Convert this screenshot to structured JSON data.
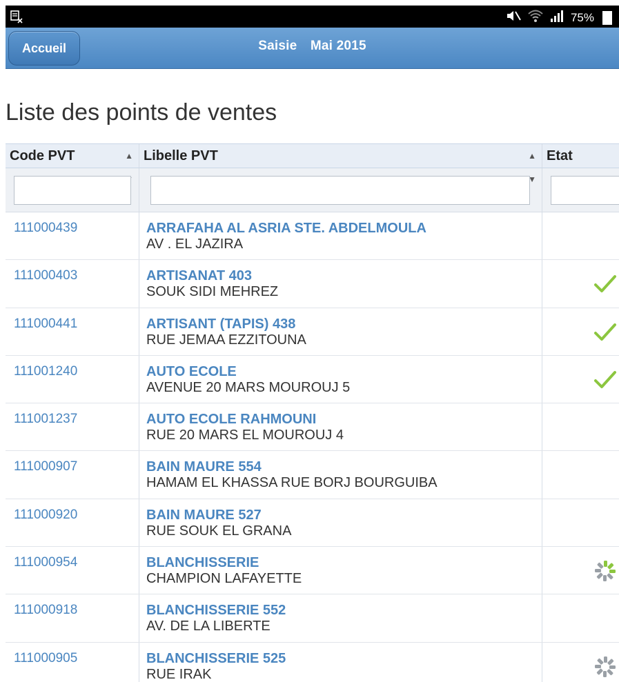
{
  "status_bar": {
    "battery": "75%",
    "icons": [
      "notification-icon",
      "mute-icon",
      "wifi-icon",
      "signal-icon",
      "battery-icon"
    ]
  },
  "header": {
    "back_label": "Accueil",
    "title_mode": "Saisie",
    "title_period": "Mai 2015"
  },
  "page": {
    "title": "Liste des points de ventes"
  },
  "table": {
    "columns": [
      "Code PVT",
      "Libelle PVT",
      "Etat"
    ],
    "rows": [
      {
        "code": "111000439",
        "name": "ARRAFAHA AL ASRIA STE. ABDELMOULA",
        "address": "AV . EL JAZIRA",
        "etat": "none"
      },
      {
        "code": "111000403",
        "name": "ARTISANAT 403",
        "address": "SOUK SIDI MEHREZ",
        "etat": "check"
      },
      {
        "code": "111000441",
        "name": "ARTISANT (TAPIS) 438",
        "address": "RUE JEMAA EZZITOUNA",
        "etat": "check"
      },
      {
        "code": "111001240",
        "name": "AUTO ECOLE",
        "address": "AVENUE 20 MARS MOUROUJ 5",
        "etat": "check"
      },
      {
        "code": "111001237",
        "name": "AUTO ECOLE RAHMOUNI",
        "address": "RUE 20 MARS EL MOUROUJ 4",
        "etat": "none"
      },
      {
        "code": "111000907",
        "name": "BAIN MAURE 554",
        "address": "HAMAM EL KHASSA RUE BORJ BOURGUIBA",
        "etat": "none"
      },
      {
        "code": "111000920",
        "name": "BAIN MAURE 527",
        "address": "RUE SOUK EL GRANA",
        "etat": "none"
      },
      {
        "code": "111000954",
        "name": "BLANCHISSERIE",
        "address": "CHAMPION LAFAYETTE",
        "etat": "pending"
      },
      {
        "code": "111000918",
        "name": "BLANCHISSERIE 552",
        "address": "AV. DE LA LIBERTE",
        "etat": "none"
      },
      {
        "code": "111000905",
        "name": "BLANCHISSERIE 525",
        "address": "RUE IRAK",
        "etat": "pending"
      }
    ]
  },
  "colors": {
    "header": "#4b87c3",
    "link": "#4a86c0",
    "check": "#8cc63f",
    "pending": "#9aa0a6"
  }
}
